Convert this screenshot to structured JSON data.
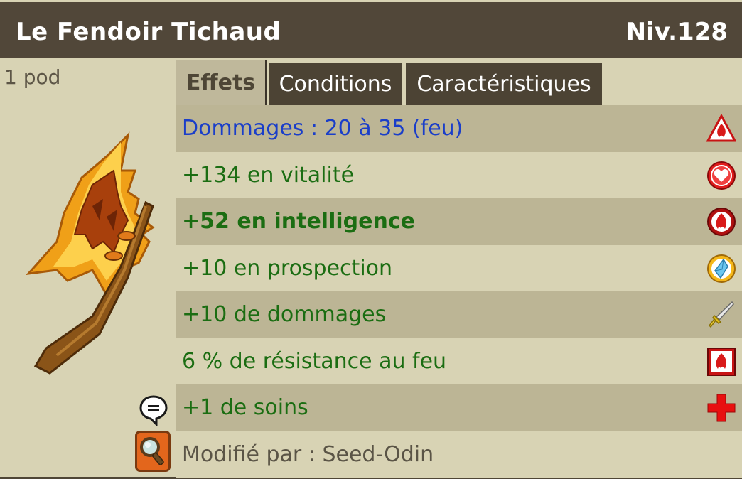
{
  "item": {
    "name": "Le Fendoir Tichaud",
    "level": "Niv.128",
    "weight": "1 pod"
  },
  "tabs": [
    {
      "label": "Effets",
      "active": true
    },
    {
      "label": "Conditions",
      "active": false
    },
    {
      "label": "Caractéristiques",
      "active": false
    }
  ],
  "effects": [
    {
      "text": "Dommages : 20 à 35 (feu)",
      "icon": "fire-damage-icon"
    },
    {
      "text": "+134 en vitalité",
      "icon": "heart-icon"
    },
    {
      "text": "+52 en intelligence",
      "icon": "fire-intelligence-icon"
    },
    {
      "text": "+10 en prospection",
      "icon": "crystal-prospection-icon"
    },
    {
      "text": "+10 de dommages",
      "icon": "sword-icon"
    },
    {
      "text": "6 % de résistance au feu",
      "icon": "fire-resistance-icon"
    },
    {
      "text": "+1 de soins",
      "icon": "red-cross-icon"
    }
  ],
  "footer": {
    "modified_by": "Modifié par : Seed-Odin"
  },
  "colors": {
    "header": "#514739",
    "background": "#d8d3b4",
    "row_dark": "#bcb595",
    "effect_green": "#1b6d12",
    "damage_blue": "#1a3ec9"
  }
}
